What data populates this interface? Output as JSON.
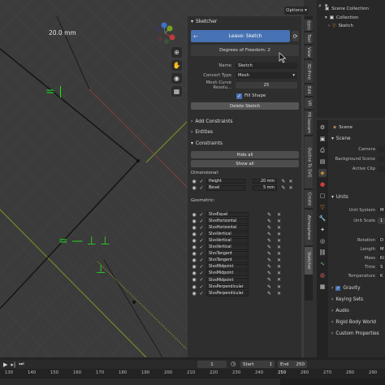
{
  "viewport": {
    "dimension_label": "20.0 mm",
    "options_label": "Options",
    "gizmo": {
      "y": "Y",
      "x": "X",
      "z": "Z"
    },
    "symbols": {
      "equal_h": "= |",
      "multi": "= — ⊥ ⊥",
      "perp": "⊥"
    }
  },
  "sketcher": {
    "panel_title": "Sketcher",
    "leave_button": "Leave: Sketch",
    "dof": "Degrees of Freedom: 2",
    "name_label": "Name",
    "name_value": "Sketch",
    "convert_label": "Convert Type",
    "convert_value": "Mesh",
    "resolution_label": "Mesh Curve Resolu...",
    "resolution_value": "25",
    "fill_shape": "Fill Shape",
    "delete_button": "Delete Sketch",
    "add_constraints": "Add Constraints",
    "entities": "Entities",
    "constraints": "Constraints",
    "hide_all": "Hide all",
    "show_all": "Show all",
    "dimensional_label": "Dimensional:",
    "dimensional": [
      {
        "name": "Height",
        "value": "20 mm"
      },
      {
        "name": "Bevel",
        "value": "5 mm"
      }
    ],
    "geometric_label": "Geometric:",
    "geometric": [
      "SlvsEqual",
      "SlvsHorizontal",
      "SlvsHorizontal",
      "SlvsVertical",
      "SlvsVertical",
      "SlvsVertical",
      "SlvsTangent",
      "SlvsTangent",
      "SlvsMidpoint",
      "SlvsMidpoint",
      "SlvsMidpoint",
      "SlvsPerpendicular",
      "SlvsPerpendicular"
    ]
  },
  "vertical_tabs": [
    "Item",
    "Tool",
    "View",
    "3D-Print",
    "Edit",
    "VR",
    "FR Isocam",
    "Outline To SVG",
    "Create",
    "Atmosphere",
    "Sketcher"
  ],
  "outliner": {
    "items": [
      "Scene Collection",
      "Collection",
      "Sketch"
    ]
  },
  "properties": {
    "scene_header": "Scene",
    "scene_panel": "Scene",
    "camera_label": "Camera",
    "background_label": "Background Scene",
    "active_clip_label": "Active Clip",
    "units_panel": "Units",
    "unit_system_label": "Unit System",
    "unit_system_value": "M",
    "unit_scale_label": "Unit Scale",
    "unit_scale_value": "1",
    "rotation_label": "Rotation",
    "rotation_value": "D",
    "length_label": "Length",
    "length_value": "M",
    "mass_label": "Mass",
    "mass_value": "Ki",
    "time_label": "Time",
    "time_value": "S",
    "temperature_label": "Temperature",
    "temperature_value": "K",
    "gravity": "Gravity",
    "keying_sets": "Keying Sets",
    "audio": "Audio",
    "rigid_body": "Rigid Body World",
    "custom_properties": "Custom Properties"
  },
  "timeline": {
    "current_frame": "1",
    "start_label": "Start",
    "start_value": "1",
    "end_label": "End",
    "end_value": "250",
    "ruler": [
      "130",
      "140",
      "150",
      "160",
      "170",
      "180",
      "190",
      "200",
      "210",
      "220",
      "230",
      "240",
      "250",
      "260",
      "270",
      "280",
      "290"
    ]
  },
  "colors": {
    "accent": "#4772b3",
    "x_axis": "#c03a3a",
    "y_axis": "#7aa020",
    "constraint": "#22d422"
  }
}
